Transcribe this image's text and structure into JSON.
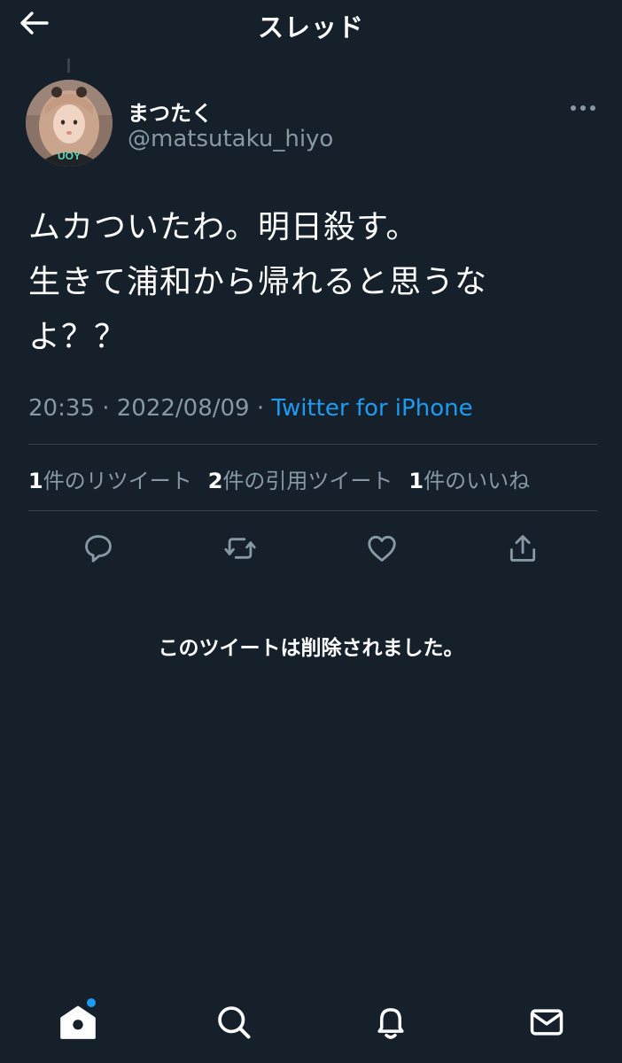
{
  "header": {
    "title": "スレッド"
  },
  "tweet": {
    "display_name": "まつたく",
    "handle": "@matsutaku_hiyo",
    "avatar_shirt_text": "UOY",
    "text_lines": [
      "ムカついたわ。明日殺す。",
      "生きて浦和から帰れると思うな",
      "よ？？"
    ],
    "time": "20:35",
    "separator": " · ",
    "date": "2022/08/09",
    "source": "Twitter for iPhone",
    "stats": [
      {
        "count": "1",
        "label": "件のリツイート"
      },
      {
        "count": "2",
        "label": "件の引用ツイート"
      },
      {
        "count": "1",
        "label": "件のいいね"
      }
    ]
  },
  "actions": [
    "reply-icon",
    "retweet-icon",
    "like-icon",
    "share-icon"
  ],
  "deleted_notice": "このツイートは削除されました。",
  "tabbar": [
    "home-icon",
    "search-icon",
    "notifications-icon",
    "messages-icon"
  ],
  "colors": {
    "background": "#15202b",
    "text": "#ffffff",
    "secondary": "#8899a6",
    "accent": "#1d9bf0",
    "divider": "#38444d"
  }
}
